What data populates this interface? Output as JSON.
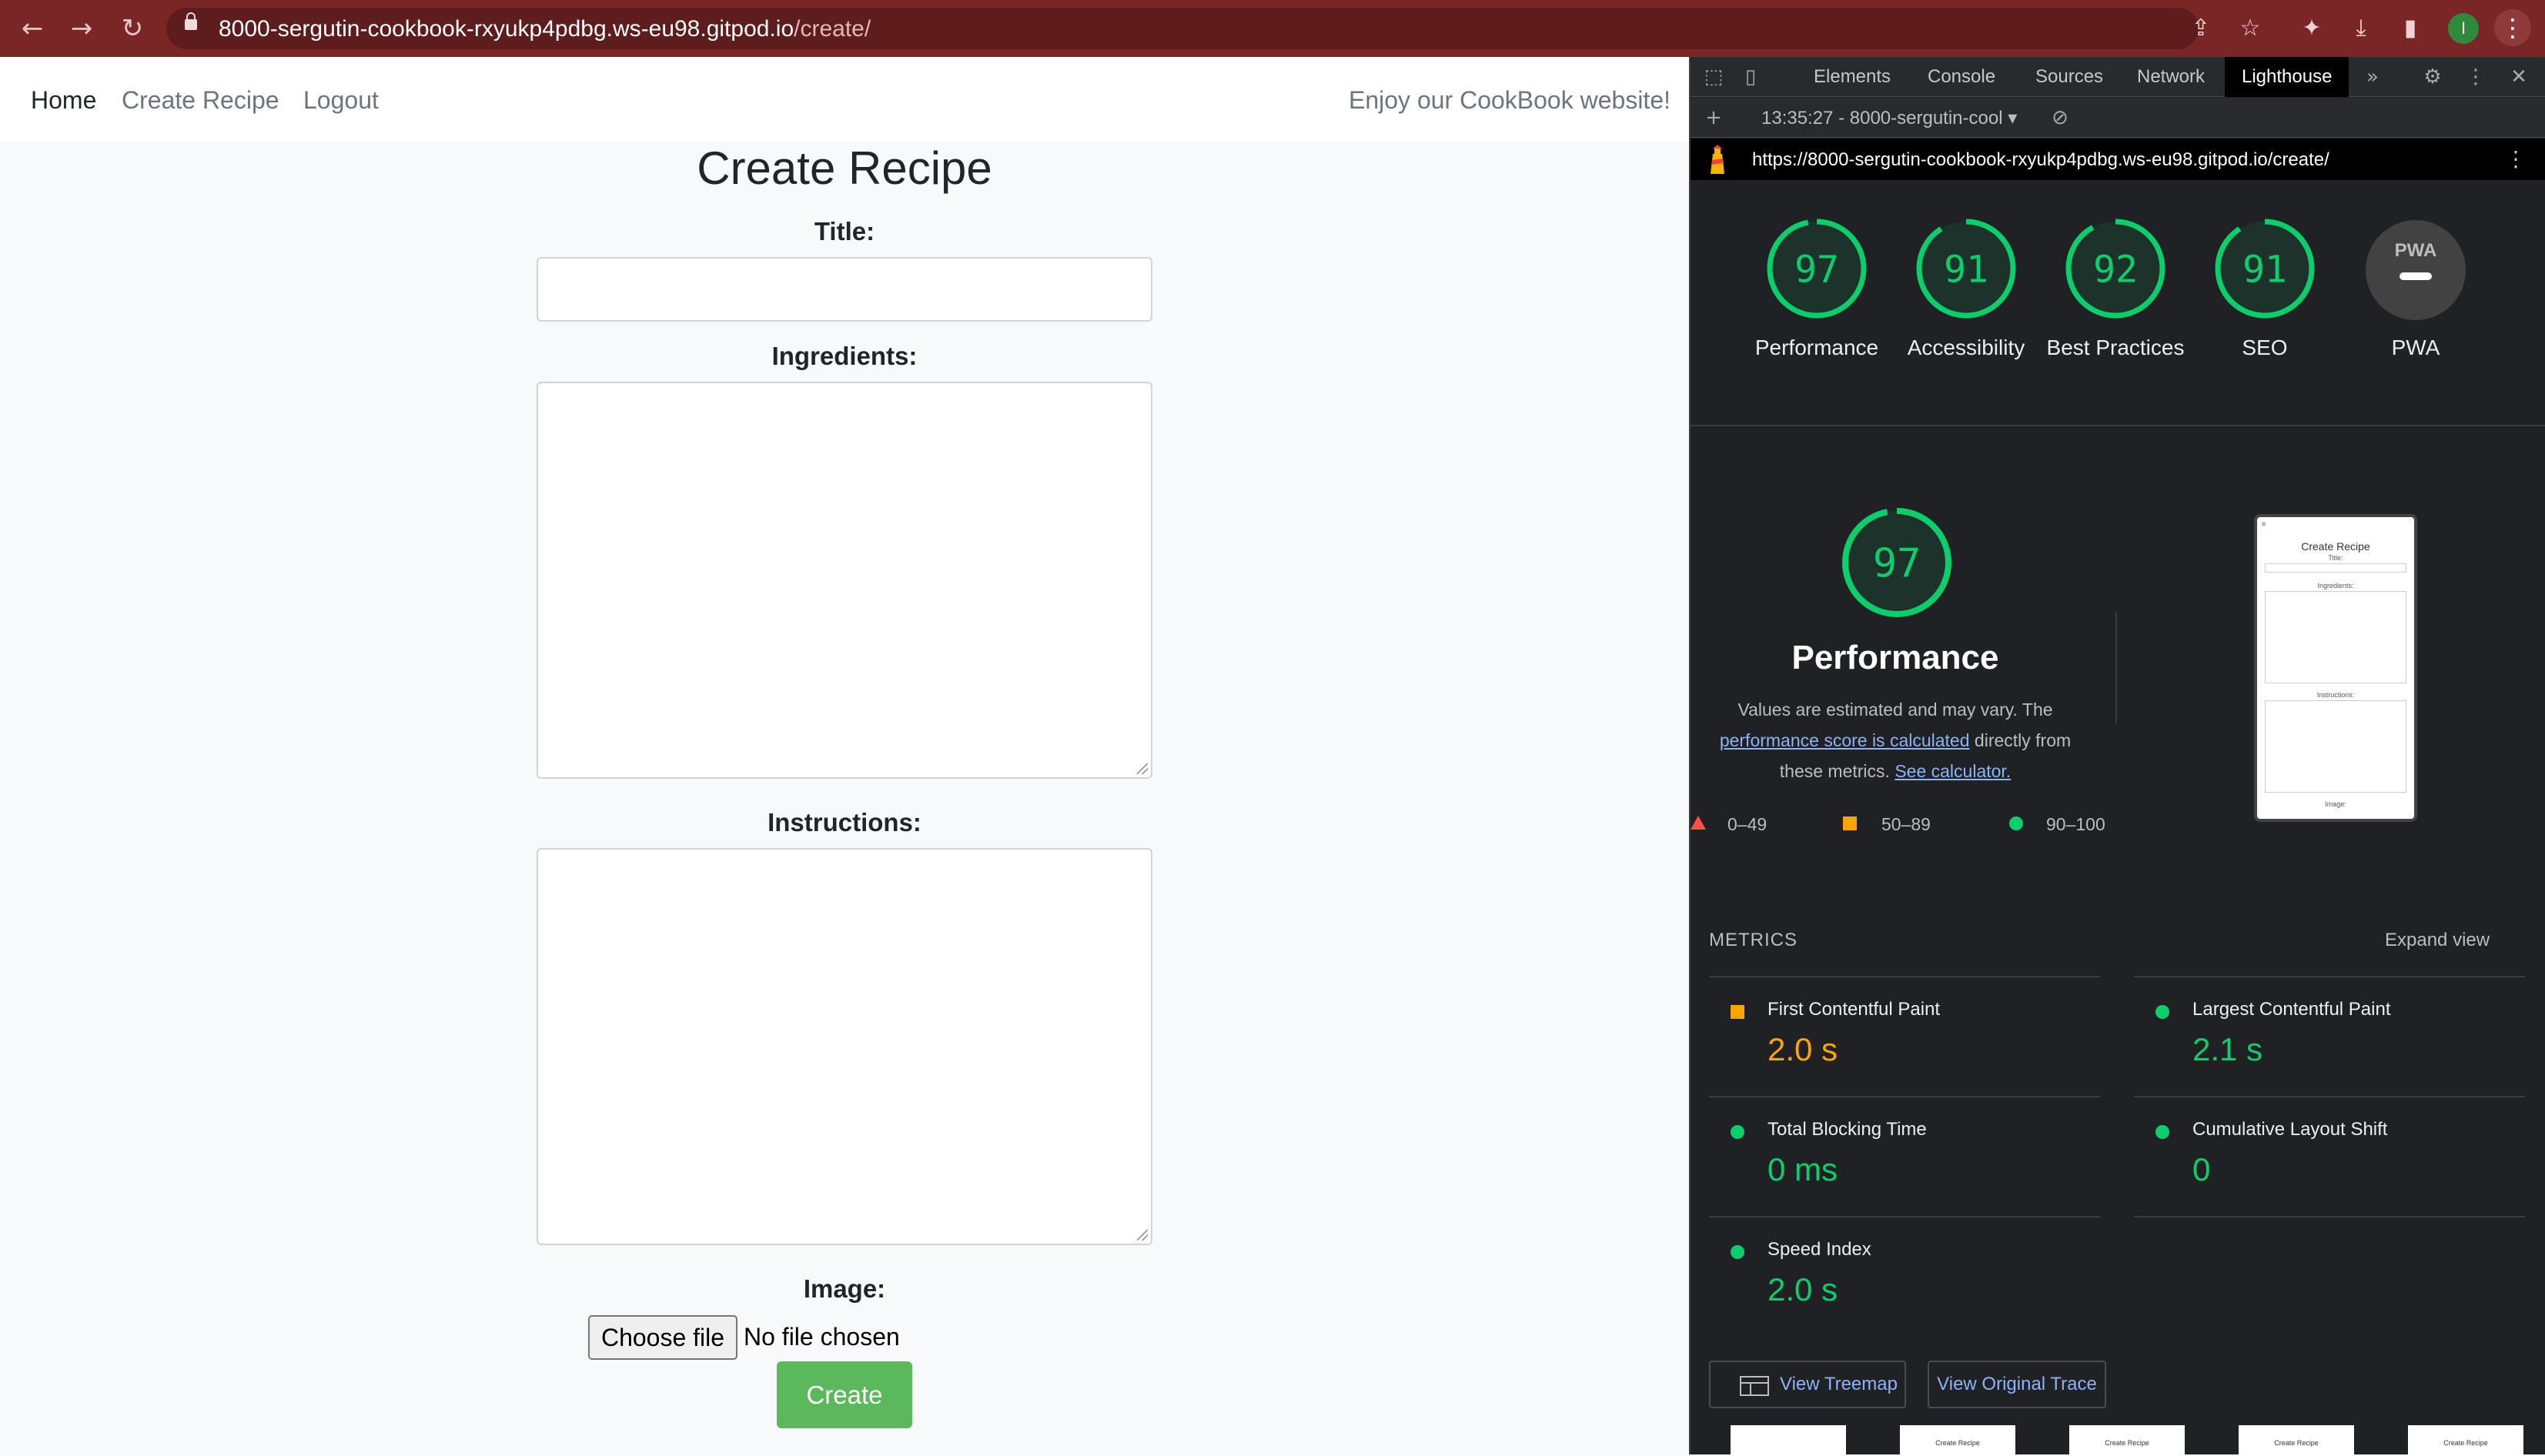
{
  "browser": {
    "url_host": "8000-sergutin-cookbook-rxyukp4pdbg.ws-eu98.gitpod.io",
    "url_path": "/create/",
    "avatar_letter": "I"
  },
  "site": {
    "nav": {
      "home": "Home",
      "create_recipe": "Create Recipe",
      "logout": "Logout"
    },
    "tagline": "Enjoy our CookBook website!",
    "page_title": "Create Recipe",
    "labels": {
      "title": "Title:",
      "ingredients": "Ingredients:",
      "instructions": "Instructions:",
      "image": "Image:"
    },
    "file_button": "Choose file",
    "file_status": "No file chosen",
    "create_button": "Create"
  },
  "devtools": {
    "tabs": [
      "Elements",
      "Console",
      "Sources",
      "Network",
      "Lighthouse"
    ],
    "active_tab": "Lighthouse",
    "report_selector": "13:35:27 - 8000-sergutin-cool",
    "report_url": "https://8000-sergutin-cookbook-rxyukp4pdbg.ws-eu98.gitpod.io/create/"
  },
  "lighthouse": {
    "scores": [
      {
        "label": "Performance",
        "value": 97
      },
      {
        "label": "Accessibility",
        "value": 91
      },
      {
        "label": "Best Practices",
        "value": 92
      },
      {
        "label": "SEO",
        "value": 91
      }
    ],
    "pwa_label": "PWA",
    "pwa_badge": "PWA",
    "perf_score": 97,
    "perf_title": "Performance",
    "perf_desc_1": "Values are estimated and may vary. The",
    "perf_desc_link": "performance score is calculated",
    "perf_desc_2": "directly from",
    "perf_desc_3": "these metrics.",
    "perf_desc_calc": "See calculator.",
    "legend": {
      "fail": "0–49",
      "average": "50–89",
      "pass": "90–100"
    },
    "thumbnail": {
      "title": "Create Recipe",
      "title_label": "Title:",
      "ingredients": "Ingredients:",
      "instructions": "Instructions:",
      "image": "Image:"
    },
    "metrics_heading": "METRICS",
    "expand_view": "Expand view",
    "metrics": [
      {
        "name": "First Contentful Paint",
        "value": "2.0 s",
        "status": "average"
      },
      {
        "name": "Largest Contentful Paint",
        "value": "2.1 s",
        "status": "pass"
      },
      {
        "name": "Total Blocking Time",
        "value": "0 ms",
        "status": "pass"
      },
      {
        "name": "Cumulative Layout Shift",
        "value": "0",
        "status": "pass"
      },
      {
        "name": "Speed Index",
        "value": "2.0 s",
        "status": "pass"
      }
    ],
    "view_treemap": "View Treemap",
    "view_trace": "View Original Trace",
    "filmstrip_label": "Create Recipe"
  },
  "colors": {
    "pass": "#0cce6b",
    "average": "#ffa400",
    "fail": "#ff4e42",
    "browser_frame": "#7b2626",
    "create_button": "#5cb85c"
  }
}
